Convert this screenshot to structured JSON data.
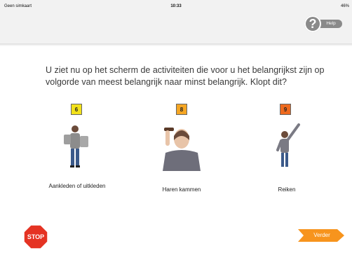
{
  "status_bar": {
    "carrier": "Geen simkaart",
    "time": "10:33",
    "battery": "46%"
  },
  "help_button": {
    "label": "Help",
    "icon": "question-icon"
  },
  "question": "U ziet nu op het scherm de activiteiten die voor u het belangrijkst zijn op volgorde van meest belangrijk naar minst belangrijk. Klopt dit?",
  "activities": [
    {
      "rank": "6",
      "label": "Aankleden of uitkleden",
      "badge_color": "#f2e11a"
    },
    {
      "rank": "8",
      "label": "Haren kammen",
      "badge_color": "#f5a623"
    },
    {
      "rank": "9",
      "label": "Reiken",
      "badge_color": "#ee6a1f"
    }
  ],
  "stop_button": {
    "label": "STOP",
    "color": "#e53323"
  },
  "next_button": {
    "label": "Verder",
    "color": "#f7941d"
  }
}
